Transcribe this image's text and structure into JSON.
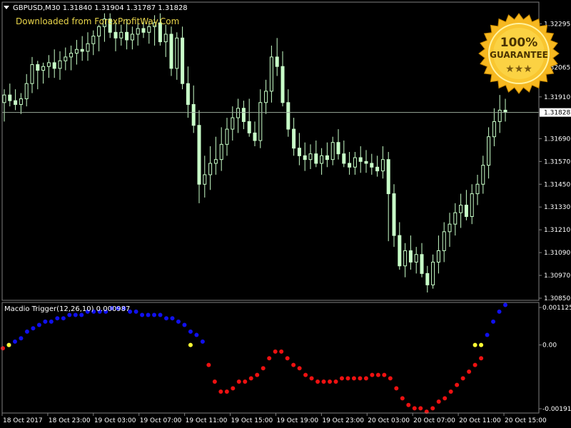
{
  "header": {
    "symbol_line": "GBPUSD,M30  1.31840 1.31904 1.31787 1.31828",
    "watermark": "Downloaded from ForexProfitWay.Com"
  },
  "badge": {
    "line1": "100%",
    "line2": "GUARANTEE",
    "stars": "★★★"
  },
  "colors": {
    "background": "#000000",
    "candle": "#c8ffc8",
    "grid": "#808080",
    "price_line": "#9aa89a",
    "macd_positive": "#1010ee",
    "macd_negative": "#ee1111",
    "macd_signal": "#ffff33",
    "badge_gold": "#f6b820"
  },
  "chart_data": [
    {
      "type": "candlestick",
      "title": "GBPUSD,M30",
      "ohlc_header": {
        "open": 1.3184,
        "high": 1.31904,
        "low": 1.31787,
        "close": 1.31828
      },
      "current_price": "1.31828",
      "ylim": [
        1.3085,
        1.32345
      ],
      "y_ticks": [
        "1.32295",
        "1.32065",
        "1.31910",
        "1.31690",
        "1.31570",
        "1.31450",
        "1.31330",
        "1.31210",
        "1.31090",
        "1.30970",
        "1.30850"
      ],
      "x_ticks": [
        "18 Oct 2017",
        "18 Oct 23:00",
        "19 Oct 03:00",
        "19 Oct 07:00",
        "19 Oct 11:00",
        "19 Oct 15:00",
        "19 Oct 19:00",
        "19 Oct 23:00",
        "20 Oct 03:00",
        "20 Oct 07:00",
        "20 Oct 11:00",
        "20 Oct 15:00"
      ],
      "candles": [
        [
          1.3188,
          1.3195,
          1.3178,
          1.3192
        ],
        [
          1.3192,
          1.3198,
          1.3186,
          1.3189
        ],
        [
          1.3189,
          1.3195,
          1.3184,
          1.3187
        ],
        [
          1.3187,
          1.3193,
          1.3182,
          1.319
        ],
        [
          1.319,
          1.3203,
          1.3186,
          1.3198
        ],
        [
          1.3198,
          1.3212,
          1.3193,
          1.3208
        ],
        [
          1.3208,
          1.321,
          1.3195,
          1.3205
        ],
        [
          1.3205,
          1.3209,
          1.3198,
          1.3207
        ],
        [
          1.3207,
          1.3213,
          1.3201,
          1.3209
        ],
        [
          1.3209,
          1.3216,
          1.3201,
          1.3206
        ],
        [
          1.3206,
          1.3215,
          1.32,
          1.321
        ],
        [
          1.321,
          1.3217,
          1.3205,
          1.3212
        ],
        [
          1.3212,
          1.3218,
          1.3205,
          1.3214
        ],
        [
          1.3214,
          1.3221,
          1.3208,
          1.3216
        ],
        [
          1.3216,
          1.3223,
          1.321,
          1.3215
        ],
        [
          1.3215,
          1.3225,
          1.321,
          1.3219
        ],
        [
          1.3219,
          1.3226,
          1.3213,
          1.3223
        ],
        [
          1.3223,
          1.3229,
          1.3215,
          1.3228
        ],
        [
          1.3228,
          1.3235,
          1.322,
          1.3232
        ],
        [
          1.3232,
          1.3235,
          1.3222,
          1.3225
        ],
        [
          1.3225,
          1.323,
          1.3215,
          1.3222
        ],
        [
          1.3222,
          1.3229,
          1.3218,
          1.3225
        ],
        [
          1.3225,
          1.3232,
          1.3216,
          1.3221
        ],
        [
          1.3221,
          1.3228,
          1.3216,
          1.3224
        ],
        [
          1.3224,
          1.323,
          1.3218,
          1.3227
        ],
        [
          1.3227,
          1.3232,
          1.3222,
          1.3225
        ],
        [
          1.3225,
          1.3231,
          1.3219,
          1.3228
        ],
        [
          1.3228,
          1.3234,
          1.3218,
          1.323
        ],
        [
          1.323,
          1.3235,
          1.3218,
          1.322
        ],
        [
          1.322,
          1.3229,
          1.3212,
          1.3224
        ],
        [
          1.3224,
          1.3228,
          1.3202,
          1.3206
        ],
        [
          1.3206,
          1.3225,
          1.32,
          1.3222
        ],
        [
          1.3222,
          1.3228,
          1.3195,
          1.3198
        ],
        [
          1.3198,
          1.3207,
          1.318,
          1.3187
        ],
        [
          1.3187,
          1.3197,
          1.3172,
          1.3176
        ],
        [
          1.3176,
          1.3184,
          1.3135,
          1.3145
        ],
        [
          1.3145,
          1.316,
          1.3138,
          1.315
        ],
        [
          1.315,
          1.3165,
          1.3142,
          1.3156
        ],
        [
          1.3156,
          1.317,
          1.315,
          1.3158
        ],
        [
          1.3158,
          1.3175,
          1.3152,
          1.3166
        ],
        [
          1.3166,
          1.318,
          1.316,
          1.3174
        ],
        [
          1.3174,
          1.3186,
          1.3168,
          1.318
        ],
        [
          1.318,
          1.319,
          1.3172,
          1.3185
        ],
        [
          1.3185,
          1.3189,
          1.3174,
          1.3178
        ],
        [
          1.3178,
          1.319,
          1.317,
          1.3172
        ],
        [
          1.3172,
          1.3178,
          1.3165,
          1.3168
        ],
        [
          1.3168,
          1.3195,
          1.3164,
          1.3188
        ],
        [
          1.3188,
          1.32,
          1.3182,
          1.3194
        ],
        [
          1.3194,
          1.3218,
          1.3188,
          1.3212
        ],
        [
          1.3212,
          1.3222,
          1.3202,
          1.3207
        ],
        [
          1.3207,
          1.3215,
          1.3186,
          1.3188
        ],
        [
          1.3188,
          1.3195,
          1.317,
          1.3174
        ],
        [
          1.3174,
          1.318,
          1.316,
          1.3164
        ],
        [
          1.3164,
          1.3172,
          1.3155,
          1.316
        ],
        [
          1.316,
          1.3167,
          1.3152,
          1.3158
        ],
        [
          1.3158,
          1.3166,
          1.3153,
          1.3161
        ],
        [
          1.3161,
          1.3168,
          1.3154,
          1.3156
        ],
        [
          1.3156,
          1.3164,
          1.315,
          1.316
        ],
        [
          1.316,
          1.3167,
          1.3154,
          1.3158
        ],
        [
          1.3158,
          1.317,
          1.3155,
          1.3167
        ],
        [
          1.3167,
          1.3174,
          1.3158,
          1.3161
        ],
        [
          1.3161,
          1.3168,
          1.3154,
          1.3156
        ],
        [
          1.3156,
          1.3162,
          1.315,
          1.3154
        ],
        [
          1.3154,
          1.3162,
          1.315,
          1.3159
        ],
        [
          1.3159,
          1.3165,
          1.3151,
          1.3157
        ],
        [
          1.3157,
          1.3163,
          1.3151,
          1.3156
        ],
        [
          1.3156,
          1.3161,
          1.315,
          1.3154
        ],
        [
          1.3154,
          1.316,
          1.3149,
          1.3152
        ],
        [
          1.3152,
          1.3165,
          1.3148,
          1.3158
        ],
        [
          1.3158,
          1.3162,
          1.3115,
          1.314
        ],
        [
          1.314,
          1.3145,
          1.3112,
          1.3118
        ],
        [
          1.3118,
          1.3125,
          1.31,
          1.3102
        ],
        [
          1.3102,
          1.3114,
          1.3096,
          1.311
        ],
        [
          1.311,
          1.3118,
          1.31,
          1.3104
        ],
        [
          1.3104,
          1.3112,
          1.3098,
          1.3108
        ],
        [
          1.3108,
          1.3114,
          1.3096,
          1.3098
        ],
        [
          1.3098,
          1.3102,
          1.3088,
          1.3092
        ],
        [
          1.3092,
          1.3108,
          1.309,
          1.3104
        ],
        [
          1.3104,
          1.3118,
          1.3098,
          1.311
        ],
        [
          1.311,
          1.3125,
          1.3104,
          1.312
        ],
        [
          1.312,
          1.313,
          1.3112,
          1.3124
        ],
        [
          1.3124,
          1.3135,
          1.3118,
          1.313
        ],
        [
          1.313,
          1.314,
          1.3122,
          1.3134
        ],
        [
          1.3134,
          1.3142,
          1.3126,
          1.3128
        ],
        [
          1.3128,
          1.3145,
          1.3124,
          1.314
        ],
        [
          1.314,
          1.315,
          1.3134,
          1.3145
        ],
        [
          1.3145,
          1.316,
          1.314,
          1.3155
        ],
        [
          1.3155,
          1.3175,
          1.3148,
          1.317
        ],
        [
          1.317,
          1.3185,
          1.3165,
          1.3178
        ],
        [
          1.3178,
          1.3192,
          1.3172,
          1.3184
        ],
        [
          1.3184,
          1.319,
          1.3178,
          1.3183
        ]
      ]
    },
    {
      "type": "scatter",
      "title": "Macdio Trigger(12,26,10) 0.000987",
      "ylim": [
        -0.001913,
        0.001125
      ],
      "y_ticks": [
        "0.001125",
        "0.00",
        "-0.001913"
      ],
      "series": [
        {
          "name": "Macdio Trigger",
          "values": [
            -0.0001,
            0.0,
            0.0001,
            0.0002,
            0.0004,
            0.0005,
            0.0006,
            0.0007,
            0.0007,
            0.0008,
            0.0008,
            0.0009,
            0.0009,
            0.0009,
            0.001,
            0.001,
            0.001,
            0.001,
            0.0011,
            0.0011,
            0.0011,
            0.001,
            0.001,
            0.0009,
            0.0009,
            0.0009,
            0.0009,
            0.0008,
            0.0008,
            0.0007,
            0.0006,
            0.0004,
            0.0003,
            0.0001,
            -0.0006,
            -0.0011,
            -0.0014,
            -0.0014,
            -0.0013,
            -0.0011,
            -0.0011,
            -0.001,
            -0.0009,
            -0.0007,
            -0.0004,
            -0.0002,
            -0.0002,
            -0.0004,
            -0.0006,
            -0.0007,
            -0.0009,
            -0.001,
            -0.0011,
            -0.0011,
            -0.0011,
            -0.0011,
            -0.001,
            -0.001,
            -0.001,
            -0.001,
            -0.001,
            -0.0009,
            -0.0009,
            -0.0009,
            -0.001,
            -0.0013,
            -0.0016,
            -0.0018,
            -0.0019,
            -0.0019,
            -0.002,
            -0.0019,
            -0.0017,
            -0.0016,
            -0.0014,
            -0.0012,
            -0.001,
            -0.0008,
            -0.0006,
            -0.0004,
            0.0003,
            0.0007,
            0.001,
            0.0012
          ],
          "colors_by_sign": {
            "positive": "#1010ee",
            "negative": "#ee1111"
          }
        },
        {
          "name": "Trigger",
          "points": [
            [
              1,
              0.0
            ],
            [
              31,
              0.0
            ],
            [
              78,
              0.0
            ],
            [
              79,
              0.0
            ]
          ],
          "color": "#ffff33"
        }
      ]
    }
  ]
}
